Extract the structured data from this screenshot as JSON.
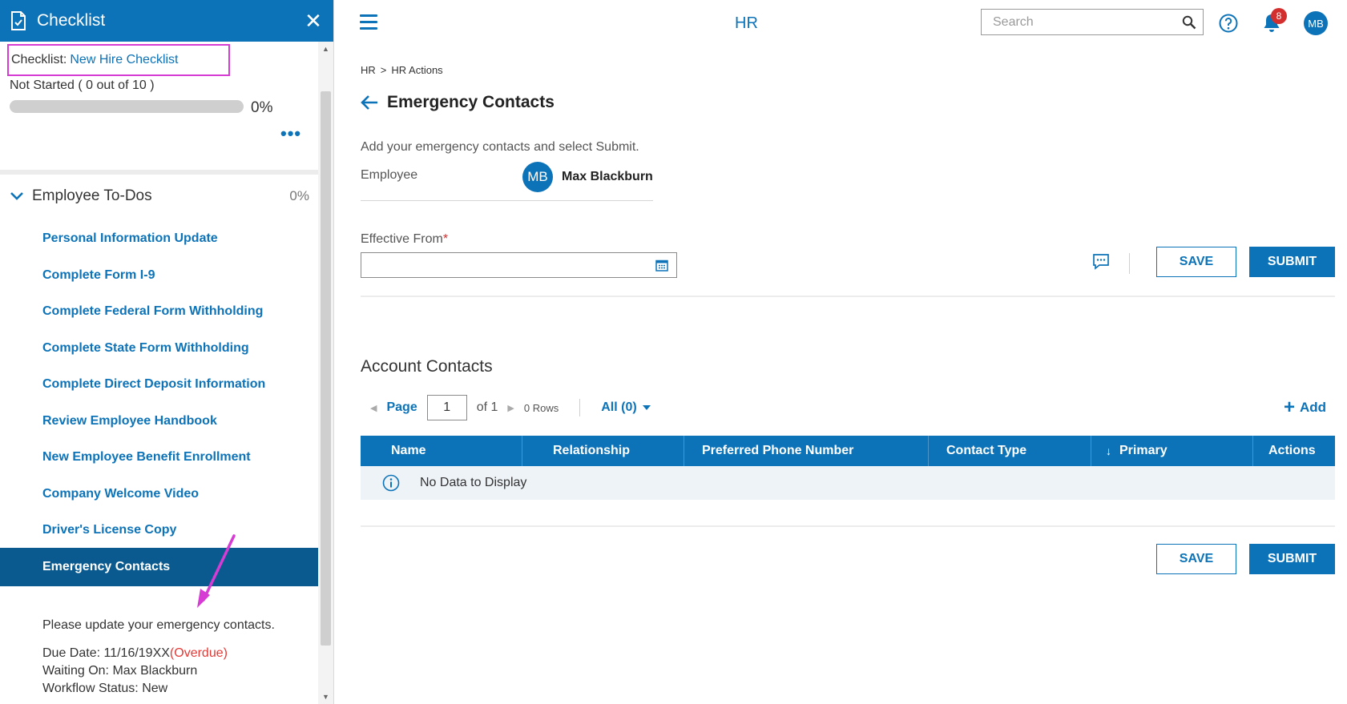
{
  "checklist_panel": {
    "title": "Checklist",
    "checklist_label": "Checklist:",
    "checklist_name": "New Hire Checklist",
    "status": "Not Started ( 0 out of 10 )",
    "progress_fraction": 0,
    "progress_text": "0%",
    "more_label": "•••",
    "section": {
      "label": "Employee To-Dos",
      "percent": "0%",
      "items": [
        {
          "label": "Personal Information Update"
        },
        {
          "label": "Complete Form I-9"
        },
        {
          "label": "Complete Federal Form Withholding"
        },
        {
          "label": "Complete State Form Withholding"
        },
        {
          "label": "Complete Direct Deposit Information"
        },
        {
          "label": "Review Employee Handbook"
        },
        {
          "label": "New Employee Benefit Enrollment"
        },
        {
          "label": "Company Welcome Video"
        },
        {
          "label": "Driver's License Copy"
        },
        {
          "label": "Emergency Contacts",
          "selected": true
        }
      ]
    },
    "selected_detail": {
      "description": "Please update your emergency contacts.",
      "due_label": "Due Date: 11/16/19XX",
      "due_flag": "(Overdue)",
      "waiting_on": "Waiting On: Max Blackburn",
      "workflow_status": "Workflow Status: New"
    }
  },
  "topbar": {
    "app_title": "HR",
    "search_placeholder": "Search",
    "notification_count": "8",
    "user_initials": "MB"
  },
  "breadcrumb": {
    "root": "HR",
    "separator": ">",
    "current": "HR Actions"
  },
  "page": {
    "title": "Emergency Contacts",
    "instruction": "Add your emergency contacts and select Submit.",
    "employee_label": "Employee",
    "employee_initials": "MB",
    "employee_name": "Max Blackburn",
    "effective_from_label": "Effective From",
    "required_mark": "*",
    "effective_from_value": "",
    "save_label": "SAVE",
    "submit_label": "SUBMIT"
  },
  "account_contacts": {
    "title": "Account Contacts",
    "page_label": "Page",
    "page_value": "1",
    "of_label": "of 1",
    "rows_label": "0 Rows",
    "filter_label": "All (0)",
    "add_label": "Add",
    "columns": [
      "Name",
      "Relationship",
      "Preferred Phone Number",
      "Contact Type",
      "Primary",
      "Actions"
    ],
    "empty_message": "No Data to Display"
  },
  "colors": {
    "brand_blue": "#0d73b8",
    "selected_row": "#0a5a8f",
    "overdue_red": "#e53935",
    "annotation_magenta": "#d63bd3"
  }
}
